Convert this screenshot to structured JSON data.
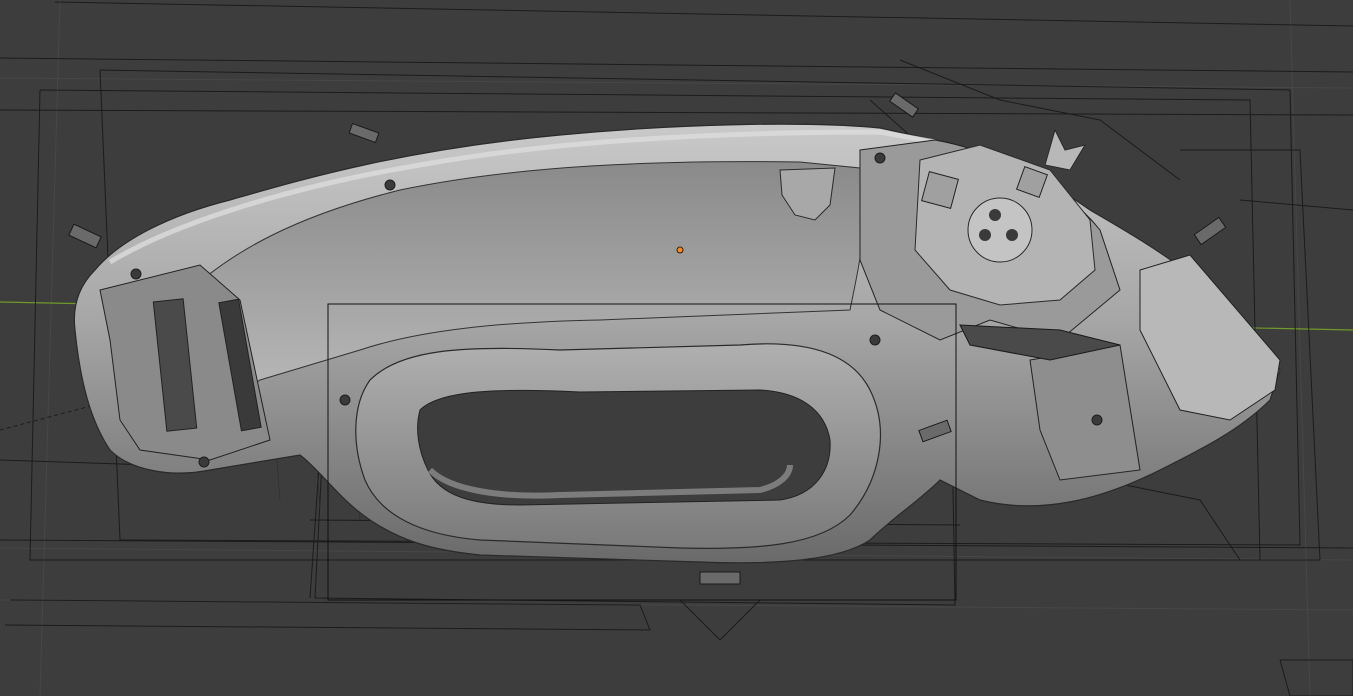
{
  "viewport": {
    "background": "#3d3d3d",
    "grid_color": "#4a4a4a",
    "x_axis_color": "#6f9a2a",
    "wireframe_color": "#151515",
    "mesh_fill": "#9a9a9a",
    "mesh_highlight": "#c8c8c8",
    "mesh_shadow": "#5a5a5a",
    "origin_color": "#f08a2a"
  },
  "object": {
    "icon": "mesh-object-icon",
    "mode": "solid-with-wireframe-overlay"
  }
}
